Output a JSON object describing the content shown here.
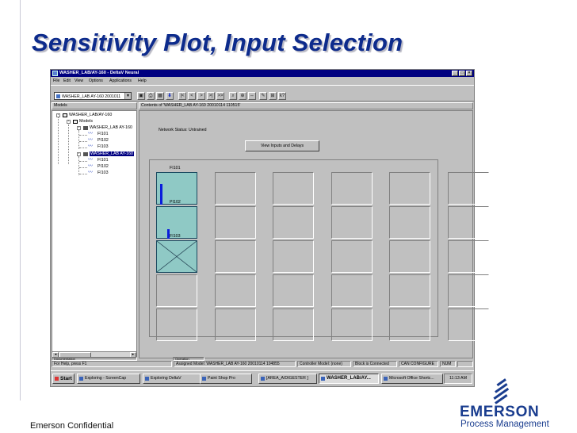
{
  "slide": {
    "title": "Sensitivity Plot, Input Selection",
    "confidential": "Emerson Confidential",
    "brand": {
      "name": "EMERSON",
      "tagline": "Process Management",
      "color": "#1a3d8f"
    },
    "title_color": "#0d2b8c"
  },
  "window": {
    "title": "WASHER_LAB/AY-160 - DeltaV Neural",
    "menu": [
      "File",
      "Edit",
      "View",
      "Options",
      "Applications",
      "Help"
    ],
    "controls": {
      "minimize": "_",
      "maximize": "□",
      "close": "×"
    },
    "model_select": {
      "value": "WASHER_LAB AY-160 2001011"
    },
    "toolbar_icons": [
      "properties-icon",
      "print-icon",
      "save-icon",
      "download-icon",
      "first-icon",
      "previous-icon",
      "next-icon",
      "last-icon",
      "fast-forward-icon",
      "zoom-icon",
      "pan-icon",
      "expand-icon",
      "edit-icon",
      "zoom-fit-icon",
      "help-icon"
    ],
    "toolbar_glyphs": [
      "▣",
      "⎙",
      "▦",
      "⬇",
      "|<",
      "<",
      ">",
      ">|",
      ">>",
      "⌕",
      "⊕",
      "⇔",
      "✎",
      "⊞",
      "k?"
    ],
    "pane_headers": {
      "models": "Models",
      "contents": "Contents of 'WASHER_LAB AY-160 20010114 110515'"
    },
    "tree": {
      "root": "WASHER_LAB/AY-160",
      "models": "Models",
      "model1": "WASHER_LAB AY-160",
      "model1_inputs": [
        "FI101",
        "PI102",
        "FI103"
      ],
      "model2": "WASHER_LAB AY-160",
      "model2_inputs": [
        "FI101",
        "PI102",
        "FI103"
      ]
    },
    "content": {
      "network_status": "Network Status: Untrained",
      "view_button": "View Inputs and Delays",
      "plots": [
        {
          "label": "FI101",
          "bar_level": 0.65
        },
        {
          "label": "PI102",
          "bar_level": 0.3
        },
        {
          "label": "FI103",
          "crossed": true
        }
      ]
    },
    "status_tabs": [
      "Documentation",
      "Operation"
    ],
    "status_bar": {
      "help": "For Help, press F1",
      "assigned_model": "Assigned Model: WASHER_LAB AY-160 20010114 104855",
      "controller_model": "Controller Model: (none)",
      "block": "Block is Connected",
      "config": "CAN CONFIGURE",
      "num": "NUM"
    },
    "taskbar": {
      "start": "Start",
      "tasks": [
        "Exploring - ScreenCap",
        "Exploring DeltaV",
        "Paint Shop Pro",
        "[AREA_A/DIGESTER ]",
        "WASHER_LAB/AY...",
        "Microsoft Office Shortc..."
      ],
      "active_index": 4,
      "clock": "11:13 AM"
    }
  },
  "colors": {
    "titlebar": "#000080",
    "cell_active": "#8fc9c5",
    "bar": "#0a1edc"
  }
}
